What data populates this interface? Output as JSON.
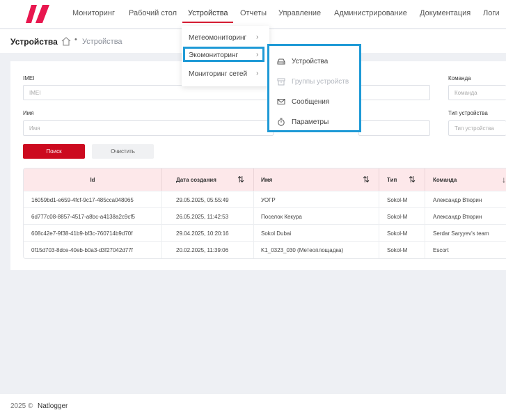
{
  "nav": {
    "items": [
      {
        "label": "Мониторинг"
      },
      {
        "label": "Рабочий стол"
      },
      {
        "label": "Устройства"
      },
      {
        "label": "Отчеты"
      },
      {
        "label": "Управление"
      },
      {
        "label": "Администрирование"
      },
      {
        "label": "Документация"
      },
      {
        "label": "Логи"
      }
    ],
    "active": "Устройства"
  },
  "breadcrumb": {
    "title": "Устройства",
    "separator": "•",
    "current": "Устройства"
  },
  "filters": {
    "imei_label": "IMEI",
    "imei_placeholder": "IMEI",
    "name_label": "Имя",
    "name_placeholder": "Имя",
    "team_label": "Команда",
    "team_placeholder": "Команда",
    "type_label": "Тип устройства",
    "type_placeholder": "Тип устройства",
    "search_label": "Поиск",
    "clear_label": "Очистить"
  },
  "table": {
    "columns": [
      "Id",
      "Дата создания",
      "Имя",
      "Тип",
      "Команда"
    ],
    "rows": [
      [
        "16059bd1-e659-4fcf-9c17-485cca048065",
        "29.05.2025, 05:55:49",
        "УОГР",
        "Sokol-M",
        "Александр Втюрин"
      ],
      [
        "6d777c08-8857-4517-a8bc-a4138a2c9cf5",
        "26.05.2025, 11:42:53",
        "Поселок Кекура",
        "Sokol-M",
        "Александр Втюрин"
      ],
      [
        "608c42e7-9f38-41b9-bf3c-760714b9d70f",
        "29.04.2025, 10:20:16",
        "Sokol Dubai",
        "Sokol-M",
        "Serdar Saryyev's team"
      ],
      [
        "0f15d703-8dce-40eb-b0a3-d3f27042d77f",
        "20.02.2025, 11:39:06",
        "K1_0323_030 (Метеоплощадка)",
        "Sokol-M",
        "Escort"
      ]
    ]
  },
  "menu1": {
    "items": [
      {
        "label": "Метеомониторинг"
      },
      {
        "label": "Экомониторинг"
      },
      {
        "label": "Мониторинг сетей"
      }
    ],
    "highlighted": "Экомониторинг"
  },
  "menu2": {
    "items": [
      {
        "label": "Устройства",
        "icon": "device-icon",
        "disabled": false
      },
      {
        "label": "Группы устройств",
        "icon": "archive-icon",
        "disabled": true
      },
      {
        "label": "Сообщения",
        "icon": "mail-icon",
        "disabled": false
      },
      {
        "label": "Параметры",
        "icon": "stopwatch-icon",
        "disabled": false
      }
    ]
  },
  "footer": {
    "copyright": "2025 ©",
    "brand": "Natlogger"
  },
  "colors": {
    "accent": "#d51c33",
    "highlight": "#1f9ad6",
    "table_header": "#fde8ea"
  }
}
